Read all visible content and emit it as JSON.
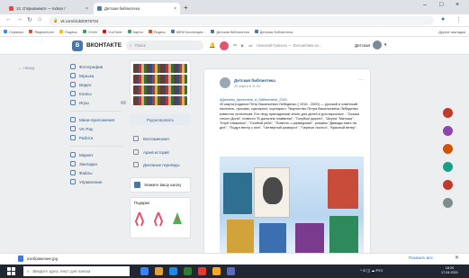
{
  "browser": {
    "tabs": [
      {
        "label": "13. Открываемся — Indexx / ",
        "active": false,
        "favicon_color": "#e04b3c"
      },
      {
        "label": "Детская библиотека",
        "active": true,
        "favicon_color": "#4a76a8"
      }
    ],
    "new_tab_label": "+",
    "url": "vk.com/club20076734",
    "bookmarks": [
      "Сервисы",
      "ЯндексКолл",
      "Подача",
      "Отчёт",
      "YouTube",
      "Карты",
      "Яндекс",
      "MEM Коллекция...",
      "Детская библиотека",
      "Детская библиотека"
    ],
    "other_bookmarks": "Другие закладки"
  },
  "vk": {
    "logo_letter": "В",
    "brand": "ВКОНТАКТЕ",
    "search_placeholder": "Поиск",
    "player_text": "Николай Гринько — Волшебник из...",
    "profile_name": "Детская",
    "back_link": "← Назад"
  },
  "leftnav": {
    "group1": [
      {
        "label": "Фотографии",
        "badge": ""
      },
      {
        "label": "Музыка",
        "badge": ""
      },
      {
        "label": "Видео",
        "badge": ""
      },
      {
        "label": "Клипы",
        "badge": ""
      },
      {
        "label": "Игры",
        "badge": "1"
      }
    ],
    "group2": [
      {
        "label": "Мини-приложения",
        "badge": ""
      },
      {
        "label": "VK Pay",
        "badge": ""
      },
      {
        "label": "Работа",
        "badge": ""
      }
    ],
    "group3": [
      {
        "label": "Маркет",
        "badge": ""
      },
      {
        "label": "Закладки",
        "badge": ""
      },
      {
        "label": "Файлы",
        "badge": ""
      },
      {
        "label": "Управление",
        "badge": ""
      }
    ]
  },
  "middle": {
    "edit_button": "Редактировать",
    "links": [
      "Воспоминания",
      "Архив историй",
      "Денежные переводы"
    ],
    "school_box": "Укажите вашу школу",
    "gifts_title": "Подарки"
  },
  "post": {
    "author": "Детская библиотека",
    "date": "20 марта в 11:00",
    "menu": "···",
    "tag": "#Должны_прочитать_в_библиотеке_2021",
    "text": "20 марта родился Петр Васильевич Лебеденко ( 1916 - 2000) — русский и советский писатель, прозаик, сценарист, сценарист. Творчество Петра Васильевича Лебеденко известно читателям. Его перу принадлежат книги для детей и для взрослых - \"Сказки тихого Дона\", повести \"В дальнем плавании\", \"Голубые дороги\", \"Шхуна \"Матьяш\", \"Клуб отважных\", \"Особый рейс\", \"Повесть о разведчике\", романы \"Дважды мать на дне\", \"Подул ветер с юга\", \"Четвертый разворот\", \"Черные листья\", \"Красный ветер\"."
  },
  "downloads": {
    "file": "изображение.jpg",
    "show_all": "Показать все",
    "close": "✕"
  },
  "taskbar": {
    "search_placeholder": "Введите здесь текст для поиска",
    "tray": "^  ⊡  ◫  ☁  РУС",
    "time": "18:25",
    "date": "17.04.2021"
  }
}
